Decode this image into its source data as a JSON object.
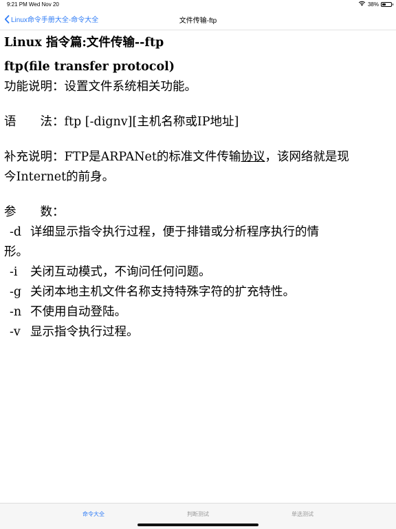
{
  "status_bar": {
    "time": "9:21 PM",
    "date": "Wed Nov 20",
    "battery_text": "38%",
    "battery_level": 0.38,
    "wifi_icon": "wifi-icon"
  },
  "nav": {
    "back_label": "Linux命令手册大全-命令大全",
    "title": "文件传输-ftp"
  },
  "content": {
    "heading": "Linux 指令篇:文件传输--ftp",
    "subheading": "ftp(file transfer protocol)",
    "function_desc": "功能说明：设置文件系统相关功能。",
    "syntax": "语　　法：ftp [-dignv][主机名称或IP地址]",
    "supplement_before_link": "补充说明：FTP是ARPANet的标准文件传输",
    "supplement_link": "协议",
    "supplement_after_link": "，该网络就是现",
    "supplement_line2": "今Internet的前身。",
    "params_title": "参　　数：",
    "params": [
      {
        "flag": "-d",
        "desc": "详细显示指令执行过程，便于排错或分析程序执行的情"
      },
      {
        "flag": "",
        "desc": "形。"
      },
      {
        "flag": "-i",
        "desc": "关闭互动模式，不询问任何问题。"
      },
      {
        "flag": "-g",
        "desc": "关闭本地主机文件名称支持特殊字符的扩充特性。"
      },
      {
        "flag": "-n",
        "desc": "不使用自动登陆。"
      },
      {
        "flag": "-v",
        "desc": "显示指令执行过程。"
      }
    ]
  },
  "tabs": [
    {
      "label": "命令大全",
      "active": true
    },
    {
      "label": "判断测试",
      "active": false
    },
    {
      "label": "单选测试",
      "active": false
    }
  ],
  "colors": {
    "accent": "#2f7cf6",
    "inactive_tab": "#9a9a9a"
  }
}
